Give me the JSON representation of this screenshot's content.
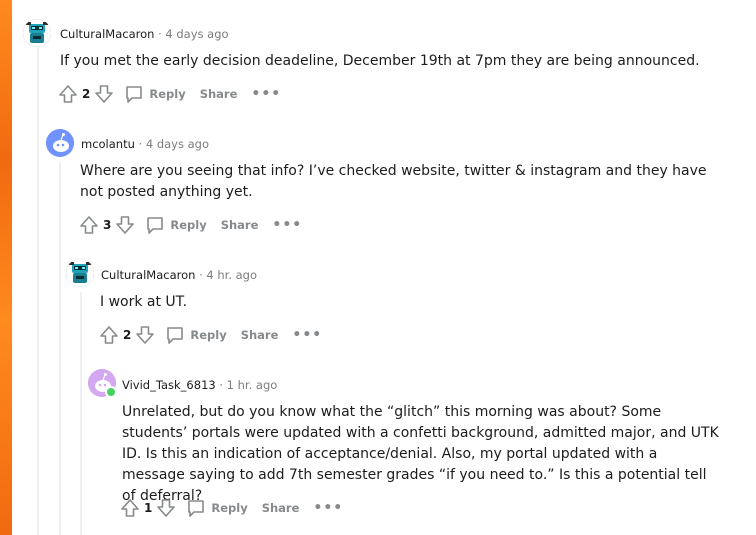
{
  "comments": [
    {
      "user": "CulturalMacaron",
      "time": "4 days ago",
      "text": "If you met the early decision deadeline, December 19th at 7pm they are being announced.",
      "votes": "2",
      "reply_label": "Reply",
      "share_label": "Share",
      "more_label": "•••"
    },
    {
      "user": "mcolantu",
      "time": "4 days ago",
      "text": "Where are you seeing that info? I’ve checked website, twitter & instagram and they have not posted anything yet.",
      "votes": "3",
      "reply_label": "Reply",
      "share_label": "Share",
      "more_label": "•••"
    },
    {
      "user": "CulturalMacaron",
      "time": "4 hr. ago",
      "text": "I work at UT.",
      "votes": "2",
      "reply_label": "Reply",
      "share_label": "Share",
      "more_label": "•••"
    },
    {
      "user": "Vivid_Task_6813",
      "time": "1 hr. ago",
      "text": "Unrelated, but do you know what the “glitch” this morning was about? Some students’ portals were updated with a confetti background, admitted major, and UTK ID. Is this an indication of acceptance/denial. Also, my portal updated with a message saying to add 7th semester grades “if you need to.” Is this a potential tell of deferral?",
      "votes": "1",
      "reply_label": "Reply",
      "share_label": "Share",
      "more_label": "•••"
    }
  ],
  "separator": "·",
  "colors": {
    "accent_orange": "#f67a1a",
    "meta_gray": "#7c7c7c",
    "action_gray": "#878a8c",
    "online_green": "#46d160"
  }
}
